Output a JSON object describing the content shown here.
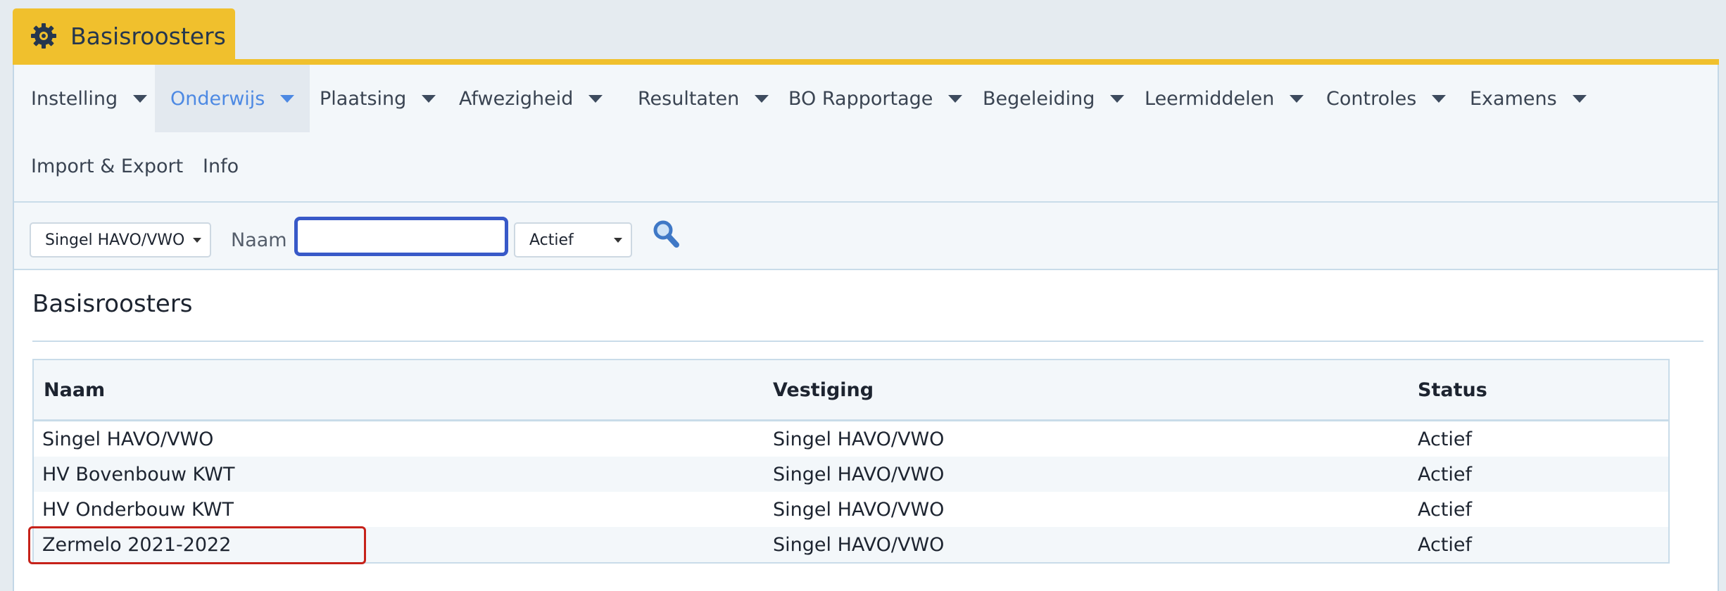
{
  "app": {
    "title": "Basisroosters",
    "accent_color": "#f0c02d",
    "icon": "gear-icon"
  },
  "menu": {
    "items": [
      {
        "id": "instelling",
        "label": "Instelling",
        "active": false
      },
      {
        "id": "onderwijs",
        "label": "Onderwijs",
        "active": true
      },
      {
        "id": "plaatsing",
        "label": "Plaatsing",
        "active": false
      },
      {
        "id": "afwezigheid",
        "label": "Afwezigheid",
        "active": false
      },
      {
        "id": "resultaten",
        "label": "Resultaten",
        "active": false
      },
      {
        "id": "bo-rapportage",
        "label": "BO Rapportage",
        "active": false
      },
      {
        "id": "begeleiding",
        "label": "Begeleiding",
        "active": false
      },
      {
        "id": "leermiddelen",
        "label": "Leermiddelen",
        "active": false
      },
      {
        "id": "controles",
        "label": "Controles",
        "active": false
      },
      {
        "id": "examens",
        "label": "Examens",
        "active": false
      },
      {
        "id": "import-export",
        "label": "Import & Export",
        "active": false
      },
      {
        "id": "info",
        "label": "Info",
        "active": false
      }
    ]
  },
  "filters": {
    "vestiging_select": "Singel HAVO/VWO",
    "naam_label": "Naam",
    "naam_value": "",
    "status_select": "Actief",
    "search_icon": "search-icon"
  },
  "section": {
    "title": "Basisroosters"
  },
  "table": {
    "columns": [
      "Naam",
      "Vestiging",
      "Status"
    ],
    "rows": [
      [
        "Singel HAVO/VWO",
        "Singel HAVO/VWO",
        "Actief"
      ],
      [
        "HV Bovenbouw KWT",
        "Singel HAVO/VWO",
        "Actief"
      ],
      [
        "HV Onderbouw KWT",
        "Singel HAVO/VWO",
        "Actief"
      ],
      [
        "Zermelo 2021-2022",
        "Singel HAVO/VWO",
        "Actief"
      ]
    ],
    "highlighted_row": 3
  }
}
